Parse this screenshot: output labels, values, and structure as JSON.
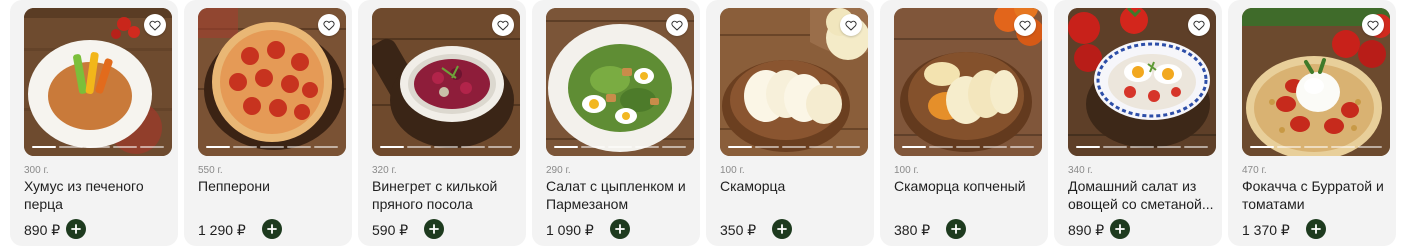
{
  "currency": "₽",
  "colors": {
    "add_button": "#1d3a1e",
    "card_bg": "#f3f3f3",
    "weight_text": "#8a8a8a"
  },
  "products": [
    {
      "weight": "300 г.",
      "name": "Хумус из печеного перца",
      "price": "890 ₽",
      "image": "hummus-plate",
      "favorite": "heart-icon"
    },
    {
      "weight": "550 г.",
      "name": "Пепперони",
      "price": "1 290 ₽",
      "image": "pepperoni-pizza",
      "favorite": "heart-icon"
    },
    {
      "weight": "320 г.",
      "name": "Винегрет с килькой пряного посола",
      "price": "590 ₽",
      "image": "vinaigrette-bowl",
      "favorite": "heart-icon"
    },
    {
      "weight": "290 г.",
      "name": "Салат с цыпленком и Пармезаном",
      "price": "1 090 ₽",
      "image": "caesar-salad",
      "favorite": "heart-icon"
    },
    {
      "weight": "100 г.",
      "name": "Скаморца",
      "price": "350 ₽",
      "image": "scamorza-cheese",
      "favorite": "heart-icon"
    },
    {
      "weight": "100 г.",
      "name": "Скаморца копченый",
      "price": "380 ₽",
      "image": "smoked-scamorza",
      "favorite": "heart-icon"
    },
    {
      "weight": "340 г.",
      "name": "Домашний салат из овощей со сметаной...",
      "price": "890 ₽",
      "image": "vegetable-salad",
      "favorite": "heart-icon"
    },
    {
      "weight": "470 г.",
      "name": "Фокачча с Бурратой и томатами",
      "price": "1 370 ₽",
      "image": "focaccia-burrata",
      "favorite": "heart-icon"
    }
  ]
}
